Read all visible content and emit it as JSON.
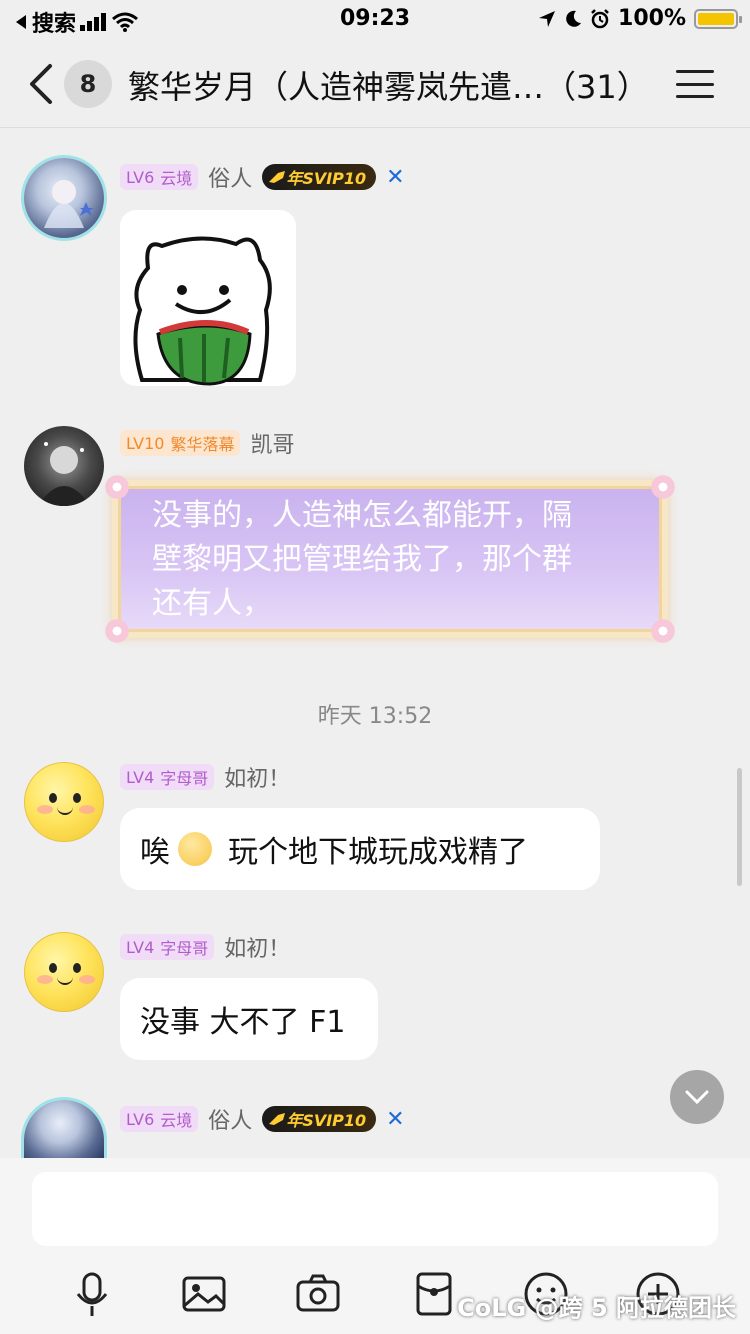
{
  "status_bar": {
    "back_app": "搜索",
    "time": "09:23",
    "battery": "100%"
  },
  "nav": {
    "badge_count": "8",
    "title": "繁华岁月（人造神雾岚先遣…（31）"
  },
  "messages": [
    {
      "level": "LV6",
      "title": "云境",
      "nickname": "俗人",
      "svip": "年SVIP10",
      "content_type": "sticker"
    },
    {
      "level": "LV10",
      "title": "繁华落幕",
      "nickname": "凯哥",
      "lines": [
        "没事的，人造神怎么都能开，隔",
        "壁黎明又把管理给我了，那个群",
        "还有人，"
      ]
    },
    {
      "level": "LV4",
      "title": "字母哥",
      "nickname": "如初！",
      "text_before_emoji": "唉",
      "text_after_emoji": "玩个地下城玩成戏精了"
    },
    {
      "level": "LV4",
      "title": "字母哥",
      "nickname": "如初！",
      "text": "没事 大不了 F1"
    },
    {
      "level": "LV6",
      "title": "云境",
      "nickname": "俗人",
      "svip": "年SVIP10"
    }
  ],
  "timestamp": "昨天 13:52",
  "watermark": "CoLG @跨 5 阿拉德团长",
  "colors": {
    "bubble_bg": "#ffffff",
    "level_purple": "#b15ccc",
    "level_orange": "#f08a2c",
    "battery_fill": "#f5c400"
  }
}
